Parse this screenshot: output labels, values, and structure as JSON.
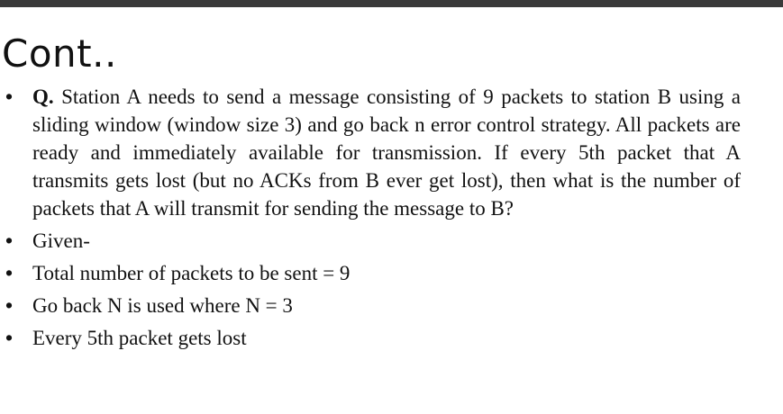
{
  "slide": {
    "title": "Cont..",
    "bullet_symbol": "•",
    "question": {
      "label": "Q.",
      "text": "Station A needs to send a message consisting of 9 packets to station B using a sliding window (window size 3) and go back n error control strategy. All packets are ready and immediately available for transmission. If every 5th packet that A transmits gets lost (but no ACKs from B ever get lost), then what is the number of packets that A will transmit for sending the message to B?"
    },
    "bullets": [
      "Given-",
      "Total number of packets to be sent = 9",
      "Go back N is used where N = 3",
      "Every 5th packet gets lost"
    ]
  }
}
